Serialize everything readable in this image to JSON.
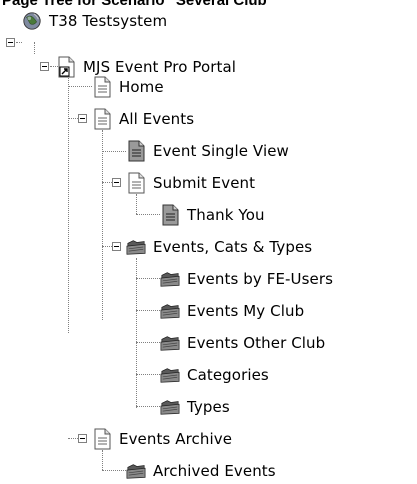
{
  "header": {
    "caption": "Page Tree for Scenario \"Several Club"
  },
  "tree": {
    "root": {
      "label": "T38 Testsystem",
      "icon": "globe-icon"
    },
    "portal": {
      "label": "MJS Event Pro Portal",
      "icon": "shortcut-page-icon"
    },
    "home": {
      "label": "Home",
      "icon": "page-icon"
    },
    "all_events": {
      "label": "All Events",
      "icon": "page-icon"
    },
    "event_single_view": {
      "label": "Event Single View",
      "icon": "page-dark-icon"
    },
    "submit_event": {
      "label": "Submit Event",
      "icon": "page-icon"
    },
    "thank_you": {
      "label": "Thank You",
      "icon": "page-dark-icon"
    },
    "events_cats_types": {
      "label": "Events, Cats & Types",
      "icon": "folder-icon"
    },
    "events_by_fe_users": {
      "label": "Events by FE-Users",
      "icon": "folder-icon"
    },
    "events_my_club": {
      "label": "Events My Club",
      "icon": "folder-icon"
    },
    "events_other_club": {
      "label": "Events Other Club",
      "icon": "folder-icon"
    },
    "categories": {
      "label": "Categories",
      "icon": "folder-icon"
    },
    "types": {
      "label": "Types",
      "icon": "folder-icon"
    },
    "events_archive": {
      "label": "Events Archive",
      "icon": "page-icon"
    },
    "archived_events": {
      "label": "Archived Events",
      "icon": "folder-icon"
    }
  }
}
